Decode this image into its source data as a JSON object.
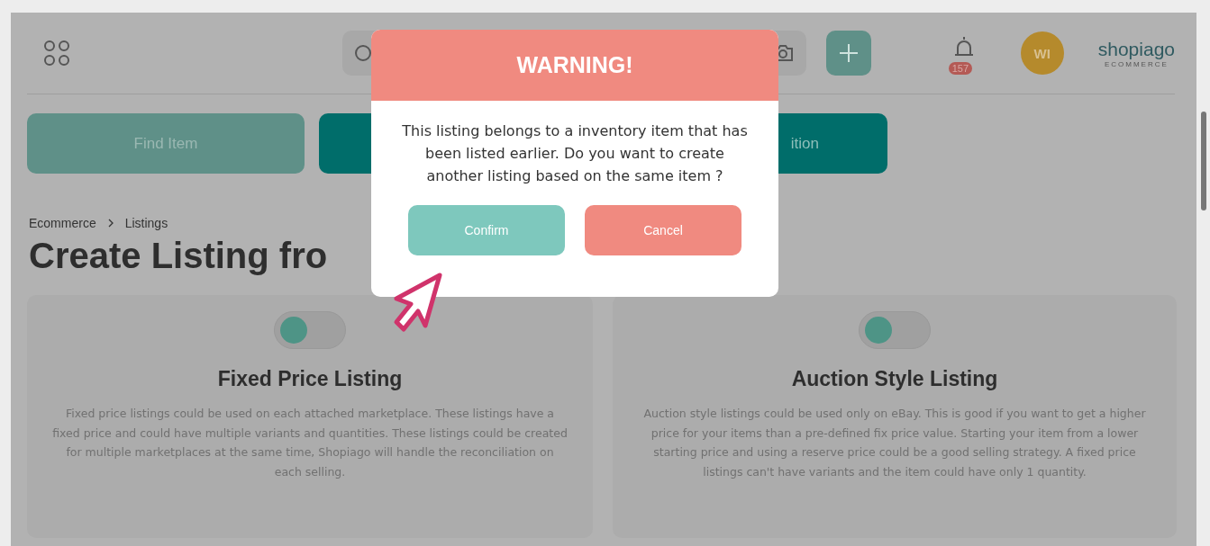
{
  "header": {
    "avatar_initials": "WI",
    "notification_count": "157",
    "logo": {
      "name": "shopiago",
      "tagline": "ECOMMERCE"
    }
  },
  "actions": [
    {
      "label": "Find Item",
      "kind": "light"
    },
    {
      "label": "ition",
      "kind": "dark"
    }
  ],
  "breadcrumb": [
    "Ecommerce",
    "Listings"
  ],
  "page_title": "Create Listing fro",
  "listing_types": [
    {
      "title": "Fixed Price Listing",
      "on": false,
      "description": "Fixed price listings could be used on each attached marketplace. These listings have a fixed price and could have multiple variants and quantities. These listings could be created for multiple marketplaces at the same time, Shopiago will handle the reconciliation on each selling."
    },
    {
      "title": "Auction Style Listing",
      "on": false,
      "description": "Auction style listings could be used only on eBay. This is good if you want to get a higher price for your items than a pre-defined fix price value. Starting your item from a lower starting price and using a reserve price could be a good selling strategy. A fixed price listings can't have variants and the item could have only 1 quantity."
    }
  ],
  "dialog": {
    "title": "WARNING!",
    "message": "This listing belongs to a inventory item that has been listed earlier. Do you want to create another listing based on the same item ?",
    "buttons": [
      {
        "label": "Confirm",
        "kind": "confirm"
      },
      {
        "label": "Cancel",
        "kind": "cancel"
      }
    ]
  }
}
